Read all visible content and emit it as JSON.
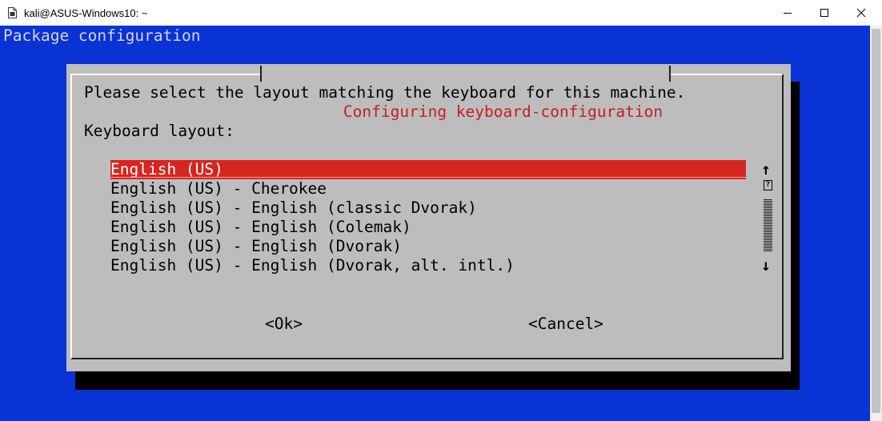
{
  "window": {
    "title": "kali@ASUS-Windows10: ~",
    "icon": "terminal-document-icon",
    "controls": [
      "minimize",
      "maximize",
      "close"
    ]
  },
  "terminal": {
    "background_color": "#0a33d6",
    "heading": "Package configuration"
  },
  "dialog": {
    "title": "Configuring keyboard-configuration",
    "prompt": "Please select the layout matching the keyboard for this machine.",
    "list_label": "Keyboard layout:",
    "layouts": [
      "English (US)",
      "English (US) - Cherokee",
      "English (US) - English (classic Dvorak)",
      "English (US) - English (Colemak)",
      "English (US) - English (Dvorak)",
      "English (US) - English (Dvorak, alt. intl.)"
    ],
    "selected_layout": "English (US)",
    "scroll_up": "↑",
    "scroll_down": "↓",
    "scroll_box": "?",
    "ok_label": "<Ok>",
    "cancel_label": "<Cancel>",
    "selection_color": "#d6261f",
    "title_color": "#c81e1e"
  }
}
